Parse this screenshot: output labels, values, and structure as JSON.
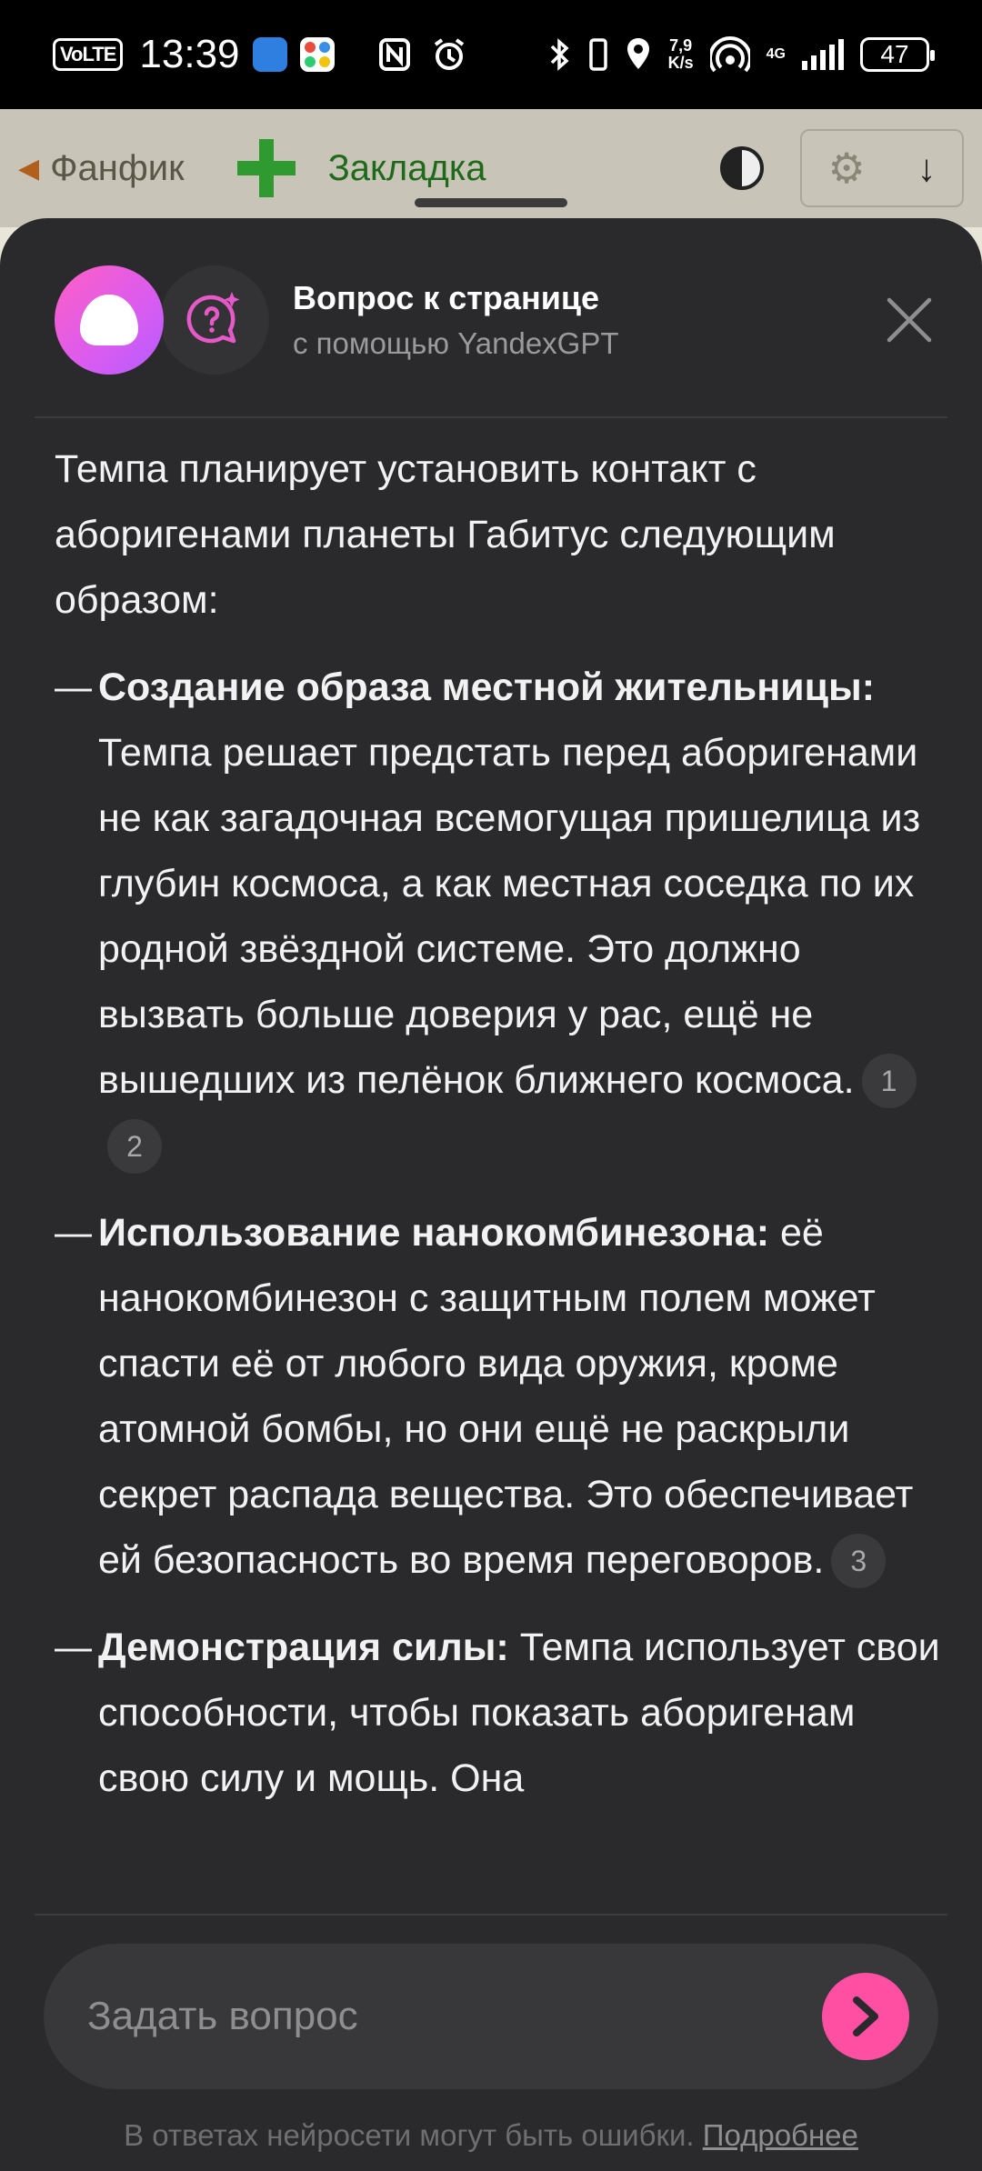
{
  "statusbar": {
    "volte": "VoLTE",
    "time": "13:39",
    "net_speed_value": "7,9",
    "net_speed_unit": "K/s",
    "network": "4G",
    "battery": "47"
  },
  "page_under": {
    "back_label": "Фанфик",
    "bookmark_label": "Закладка"
  },
  "sheet": {
    "title": "Вопрос к странице",
    "subtitle": "с помощью YandexGPT",
    "answer": {
      "intro": "Темпа планирует установить контакт с аборигенами планеты Габитус следующим образом:",
      "items": [
        {
          "heading": "Создание образа местной жительницы:",
          "text": " Темпа решает предстать перед аборигенами не как загадочная всемогущая пришелица из глубин космоса, а как местная соседка по их родной звёздной системе. Это должно вызвать больше доверия у рас, ещё не вышедших из пелёнок ближнего космоса.",
          "citations": [
            "1",
            "2"
          ]
        },
        {
          "heading": "Использование нанокомбинезона:",
          "text": " её нанокомбинезон с защитным полем может спасти её от любого вида оружия, кроме атомной бомбы, но они ещё не раскрыли секрет распада вещества. Это обеспечивает ей безопасность во время переговоров.",
          "citations": [
            "3"
          ]
        },
        {
          "heading": "Демонстрация силы:",
          "text": " Темпа использует свои способности, чтобы показать аборигенам свою силу и мощь. Она",
          "citations": []
        }
      ]
    },
    "input_placeholder": "Задать вопрос",
    "disclaimer": "В ответах нейросети могут быть ошибки.",
    "disclaimer_link": "Подробнее"
  }
}
